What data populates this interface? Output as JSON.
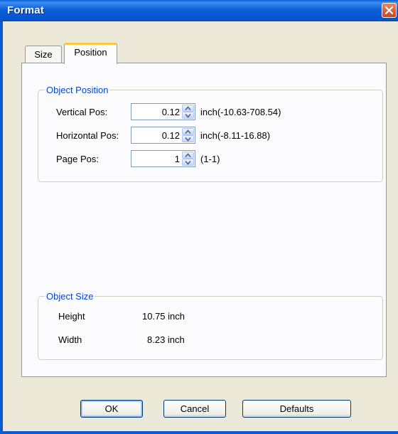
{
  "window": {
    "title": "Format"
  },
  "tabs": [
    {
      "label": "Size",
      "active": false
    },
    {
      "label": "Position",
      "active": true
    }
  ],
  "object_position": {
    "legend": "Object Position",
    "rows": [
      {
        "label": "Vertical Pos:",
        "value": "0.12",
        "range": "inch(-10.63-708.54)"
      },
      {
        "label": "Horizontal Pos:",
        "value": "0.12",
        "range": "inch(-8.11-16.88)"
      },
      {
        "label": "Page Pos:",
        "value": "1",
        "range": "(1-1)"
      }
    ]
  },
  "object_size": {
    "legend": "Object Size",
    "rows": [
      {
        "label": "Height",
        "value": "10.75 inch"
      },
      {
        "label": "Width",
        "value": "8.23 inch"
      }
    ]
  },
  "buttons": {
    "ok": "OK",
    "cancel": "Cancel",
    "defaults": "Defaults"
  },
  "colors": {
    "titlebar": "#0b5fd9",
    "legend_text": "#0046d5",
    "tab_highlight": "#ffc73c",
    "close_button": "#c94521",
    "dialog_bg": "#ece9d8"
  },
  "icons": {
    "close": "close-icon",
    "spin_up": "spin-up-arrow-icon",
    "spin_down": "spin-down-arrow-icon"
  }
}
